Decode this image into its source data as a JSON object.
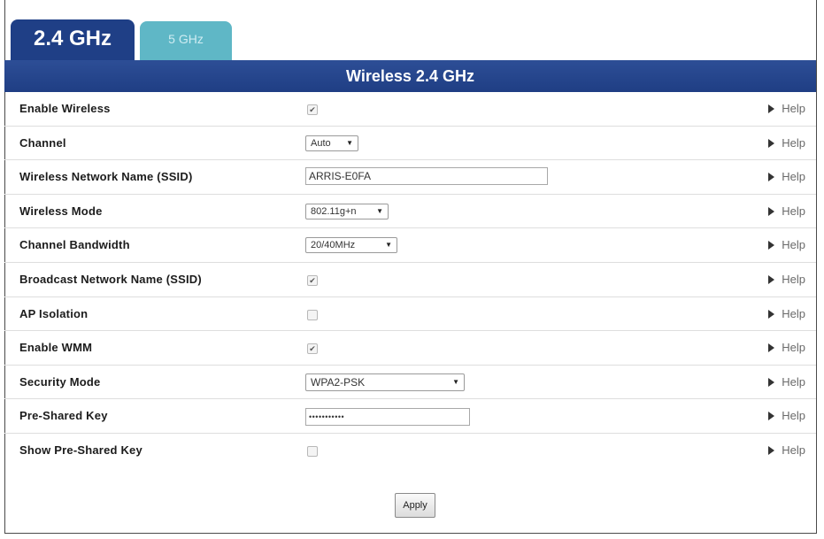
{
  "tabs": [
    {
      "label": "2.4 GHz",
      "active": true
    },
    {
      "label": "5 GHz",
      "active": false
    }
  ],
  "header": {
    "title": "Wireless 2.4 GHz"
  },
  "rows": {
    "enable_wireless": {
      "label": "Enable Wireless",
      "checked": true
    },
    "channel": {
      "label": "Channel",
      "value": "Auto"
    },
    "ssid": {
      "label": "Wireless Network Name (SSID)",
      "value": "ARRIS-E0FA"
    },
    "mode": {
      "label": "Wireless Mode",
      "value": "802.11g+n"
    },
    "bandwidth": {
      "label": "Channel Bandwidth",
      "value": "20/40MHz"
    },
    "broadcast": {
      "label": "Broadcast Network Name (SSID)",
      "checked": true
    },
    "ap_isolation": {
      "label": "AP Isolation",
      "checked": false
    },
    "wmm": {
      "label": "Enable WMM",
      "checked": true
    },
    "security": {
      "label": "Security Mode",
      "value": "WPA2-PSK"
    },
    "psk": {
      "label": "Pre-Shared Key",
      "value": "•••••••••••"
    },
    "show_psk": {
      "label": "Show Pre-Shared Key",
      "checked": false
    }
  },
  "help_label": "Help",
  "apply_label": "Apply",
  "colors": {
    "header": "#1f3f86",
    "tab_inactive": "#5fb7c6"
  },
  "icons": {
    "help": "triangle-right-icon",
    "checkbox_checked": "check-mark-icon",
    "select": "dropdown-arrow-icon"
  }
}
